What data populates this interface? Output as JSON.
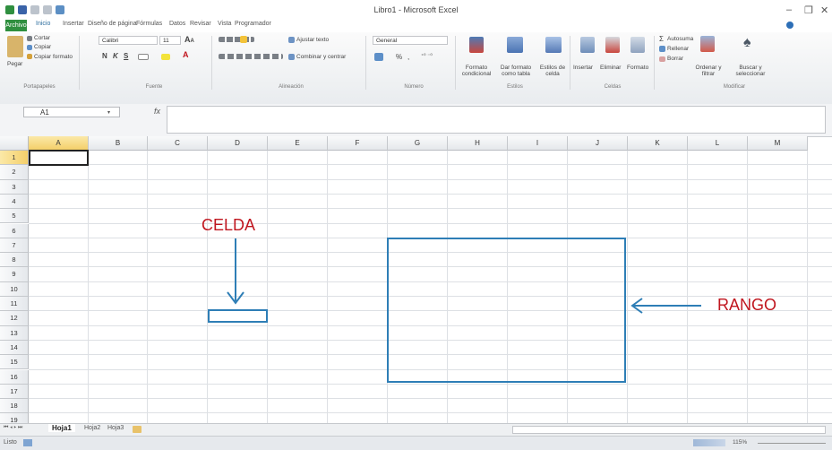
{
  "window": {
    "title": "Libro1 - Microsoft Excel",
    "minimize": "–",
    "restore": "❐",
    "close": "✕"
  },
  "ribbon_tabs": [
    "Archivo",
    "Inicio",
    "Insertar",
    "Diseño de página",
    "Fórmulas",
    "Datos",
    "Revisar",
    "Vista",
    "Programador"
  ],
  "clipboard": {
    "paste": "Pegar",
    "cut": "Cortar",
    "copy": "Copiar",
    "format_painter": "Copiar formato",
    "group": "Portapapeles"
  },
  "font": {
    "name": "Calibri",
    "size": "11",
    "bold": "N",
    "italic": "K",
    "underline": "S",
    "group": "Fuente"
  },
  "alignment": {
    "wrap": "Ajustar texto",
    "merge": "Combinar y centrar",
    "group": "Alineación"
  },
  "number": {
    "format": "General",
    "group": "Número"
  },
  "styles": {
    "conditional": "Formato condicional",
    "as_table": "Dar formato como tabla",
    "cell_styles": "Estilos de celda",
    "group": "Estilos"
  },
  "cells": {
    "insert": "Insertar",
    "delete": "Eliminar",
    "format": "Formato",
    "group": "Celdas"
  },
  "editing": {
    "autosum": "Autosuma",
    "fill": "Rellenar",
    "clear": "Borrar",
    "sort_filter": "Ordenar y filtrar",
    "find_select": "Buscar y seleccionar",
    "group": "Modificar"
  },
  "formula_bar": {
    "name_box": "A1",
    "fx": "fx",
    "value": ""
  },
  "columns": [
    "A",
    "B",
    "C",
    "D",
    "E",
    "F",
    "G",
    "H",
    "I",
    "J",
    "K",
    "L",
    "M"
  ],
  "rows": [
    "1",
    "2",
    "3",
    "4",
    "5",
    "6",
    "7",
    "8",
    "9",
    "10",
    "11",
    "12",
    "13",
    "14",
    "15",
    "16",
    "17",
    "18",
    "19"
  ],
  "annotations": {
    "cell": "CELDA",
    "range": "RANGO"
  },
  "sheets": [
    "Hoja1",
    "Hoja2",
    "Hoja3"
  ],
  "status": {
    "mode": "Listo",
    "zoom": "115%"
  },
  "colors": {
    "file_tab": "#2f8f3f",
    "annotation_text": "#c0161f",
    "annotation_shape": "#2e7eb6"
  }
}
